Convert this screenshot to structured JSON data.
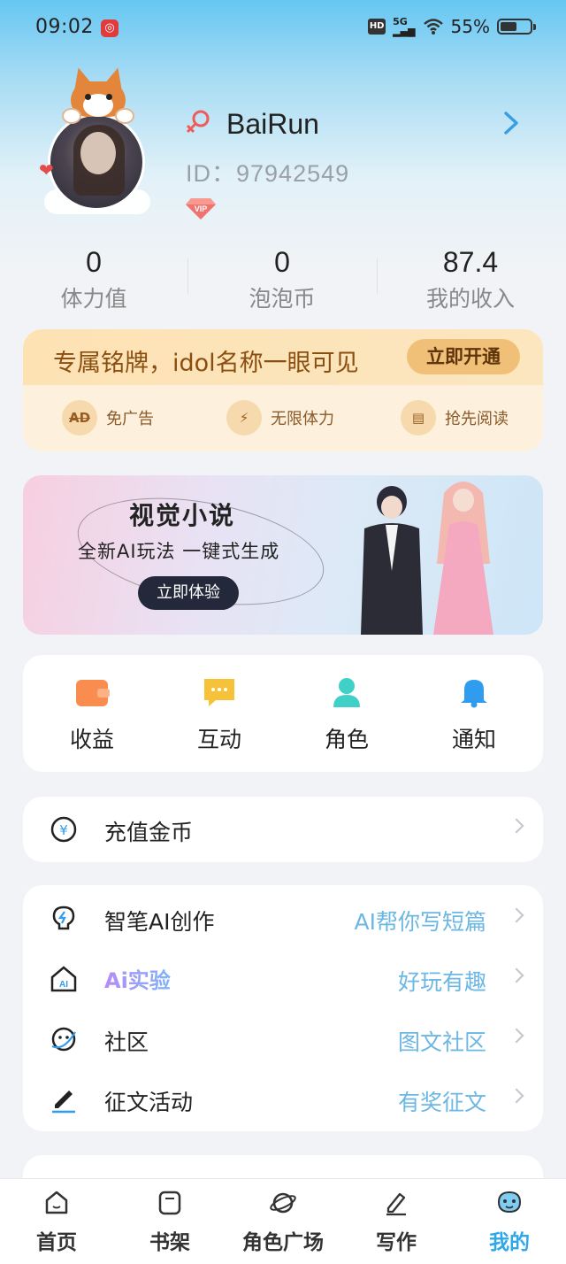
{
  "status_bar": {
    "time": "09:02",
    "network": "5G",
    "battery": "55%",
    "battery_level": 0.55,
    "icons": [
      "netease-music-icon",
      "hd-icon",
      "signal-icon",
      "wifi-icon",
      "battery-icon"
    ]
  },
  "profile": {
    "username": "BaiRun",
    "id_text": "ID：97942549",
    "badge": "VIP"
  },
  "stats": [
    {
      "value": "0",
      "label": "体力值"
    },
    {
      "value": "0",
      "label": "泡泡币"
    },
    {
      "value": "87.4",
      "label": "我的收入"
    }
  ],
  "membership": {
    "title": "专属铭牌，idol名称一眼可见",
    "button": "立即开通",
    "perks": [
      {
        "icon": "ad",
        "icon_text": "AD",
        "label": "免广告"
      },
      {
        "icon": "lightning",
        "icon_text": "⚡",
        "label": "无限体力"
      },
      {
        "icon": "book",
        "icon_text": "▤",
        "label": "抢先阅读"
      }
    ]
  },
  "promo": {
    "title": "视觉小说",
    "subtitle": "全新AI玩法 一键式生成",
    "button": "立即体验"
  },
  "quick_actions": [
    {
      "label": "收益",
      "icon": "wallet-icon",
      "color": "#f98d4f"
    },
    {
      "label": "互动",
      "icon": "chat-icon",
      "color": "#f6c23a"
    },
    {
      "label": "角色",
      "icon": "person-icon",
      "color": "#3fd0c7"
    },
    {
      "label": "通知",
      "icon": "bell-icon",
      "color": "#2f9cf0"
    }
  ],
  "recharge": {
    "label": "充值金币",
    "icon": "yuan-coin-icon"
  },
  "menu": [
    {
      "label": "智笔AI创作",
      "hint": "AI帮你写短篇",
      "icon": "lightbulb-icon"
    },
    {
      "label": "Ai实验",
      "hint": "好玩有趣",
      "icon": "ai-house-icon"
    },
    {
      "label": "社区",
      "hint": "图文社区",
      "icon": "planet-icon"
    },
    {
      "label": "征文活动",
      "hint": "有奖征文",
      "icon": "pen-icon"
    }
  ],
  "tabbar": [
    {
      "label": "首页",
      "icon": "home-icon"
    },
    {
      "label": "书架",
      "icon": "bookshelf-icon"
    },
    {
      "label": "角色广场",
      "icon": "planet-icon"
    },
    {
      "label": "写作",
      "icon": "write-icon"
    },
    {
      "label": "我的",
      "icon": "me-icon",
      "active": true
    }
  ],
  "colors": {
    "accent_blue": "#2fa8e8",
    "hint_blue": "#6cb7e3",
    "gold_text": "#8a4f10"
  }
}
